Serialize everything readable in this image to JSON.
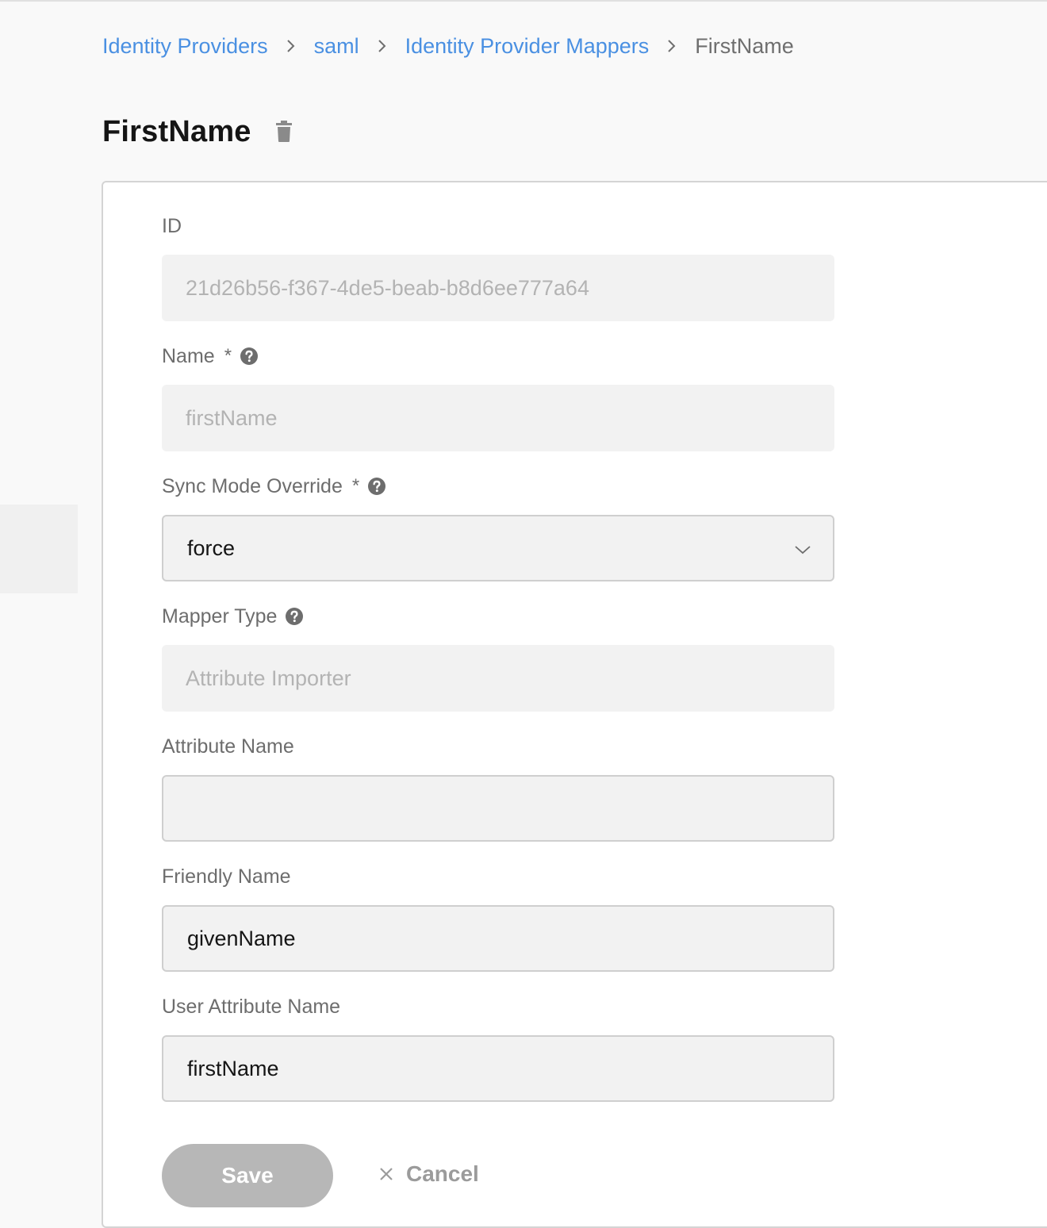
{
  "breadcrumb": {
    "items": [
      {
        "label": "Identity Providers"
      },
      {
        "label": "saml"
      },
      {
        "label": "Identity Provider Mappers"
      }
    ],
    "current": "FirstName"
  },
  "page": {
    "title": "FirstName",
    "delete_icon": "trash-icon"
  },
  "form": {
    "required_marker": "*",
    "id": {
      "label": "ID",
      "value": "21d26b56-f367-4de5-beab-b8d6ee777a64"
    },
    "name": {
      "label": "Name",
      "value": "firstName"
    },
    "sync_mode": {
      "label": "Sync Mode Override",
      "value": "force"
    },
    "mapper_type": {
      "label": "Mapper Type",
      "value": "Attribute Importer"
    },
    "attribute_name": {
      "label": "Attribute Name",
      "value": ""
    },
    "friendly_name": {
      "label": "Friendly Name",
      "value": "givenName"
    },
    "user_attribute_name": {
      "label": "User Attribute Name",
      "value": "firstName"
    }
  },
  "actions": {
    "save_label": "Save",
    "cancel_label": "Cancel"
  },
  "colors": {
    "link": "#4a90e2",
    "title": "#151515",
    "save_disabled": "#b7b7b7",
    "input_bg": "#f2f2f2"
  }
}
